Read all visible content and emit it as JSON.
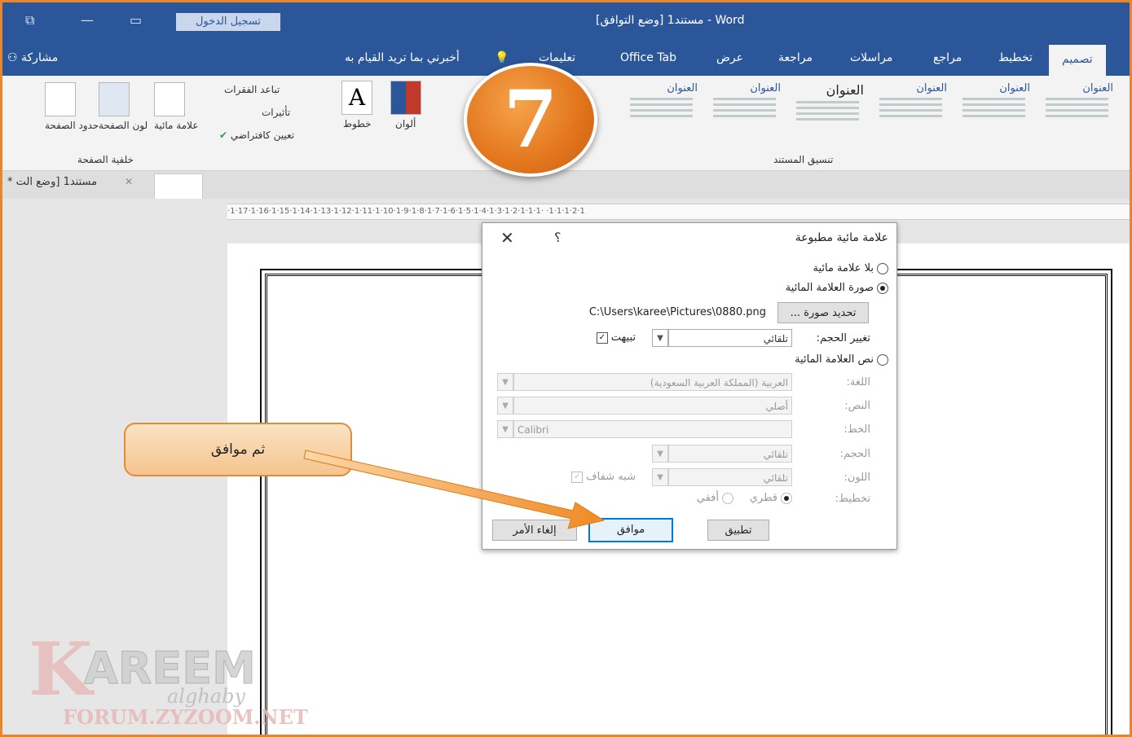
{
  "titlebar": {
    "title": "مستند1 [وضع التوافق] - Word",
    "signin": "تسجيل الدخول"
  },
  "tabs": {
    "share": "مشاركة",
    "tell_me": "أخبرني بما تريد القيام به",
    "items": [
      "تعليمات",
      "Office Tab",
      "عرض",
      "مراجعة",
      "مراسلات",
      "مراجع",
      "تخطيط",
      "تصميم"
    ],
    "active": "تصميم"
  },
  "ribbon": {
    "page_background_group": "خلفية الصفحة",
    "page_borders": "حدود الصفحة",
    "page_color": "لون الصفحة",
    "watermark": "علامة مائية",
    "paragraph_spacing": "تباعد الفقرات",
    "effects": "تأثيرات",
    "set_default": "تعيين كافتراضي",
    "fonts": "خطوط",
    "colors": "ألوان",
    "doc_format_group": "تنسيق المستند",
    "style_titles": [
      "العنوان",
      "العنوان",
      "العنوان",
      "العنوان",
      "العنوان",
      "العنوان"
    ]
  },
  "doc_tab": {
    "label": "* مستند1 [وضع الت"
  },
  "ruler": {
    "text": "·1·17·1·16·1·15·1·14·1·13·1·12·1·11·1·10·1·9·1·8·1·7·1·6·1·5·1·4·1·3·1·2·1·1·1· ·1·1·1·2·1"
  },
  "dialog": {
    "title": "علامة مائية مطبوعة",
    "help": "؟",
    "close": "✕",
    "no_watermark": "بلا علامة مائية",
    "picture_watermark": "صورة العلامة المائية",
    "select_picture": "تحديد صورة ...",
    "picture_path": "C:\\Users\\karee\\Pictures\\0880.png",
    "scale_label": "تغيير الحجم:",
    "scale_value": "تلقائي",
    "washout": "تبيهت",
    "text_watermark": "نص العلامة المائية",
    "language_label": "اللغة:",
    "language_value": "العربية (المملكة العربية السعودية)",
    "text_label": "النص:",
    "text_value": "أصلي",
    "font_label": "الخط:",
    "font_value": "Calibri",
    "size_label": "الحجم:",
    "size_value": "تلقائي",
    "color_label": "اللون:",
    "color_value": "تلقائي",
    "semitransparent": "شبه شفاف",
    "layout_label": "تخطيط:",
    "diagonal": "قطري",
    "horizontal": "أفقي",
    "apply": "تطبيق",
    "ok": "موافق",
    "cancel": "إلغاء الأمر"
  },
  "overlay": {
    "step_number": "7",
    "callout": "ثم موافق"
  },
  "watermark_logo": {
    "line1": "KAREEM",
    "line2": "alghaby",
    "line3": "FORUM.ZYZOOM.NET"
  },
  "colors": {
    "word_blue": "#2b579a",
    "accent_orange": "#e8862e"
  }
}
